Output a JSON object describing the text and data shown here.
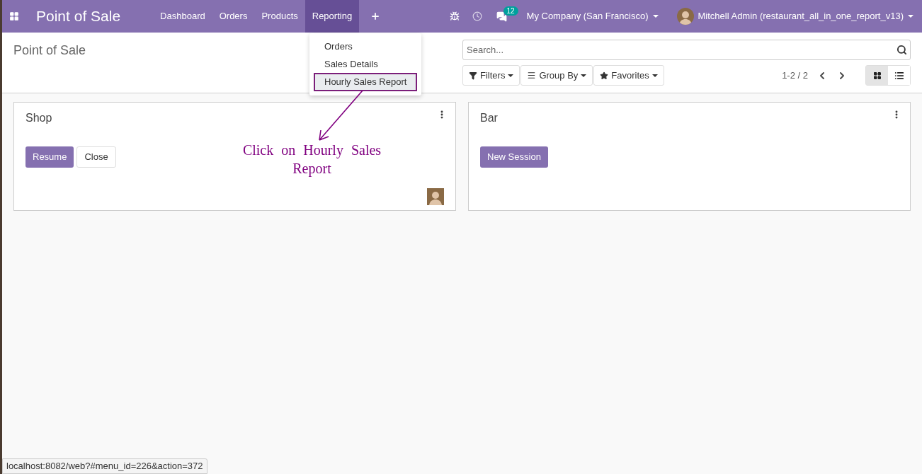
{
  "navbar": {
    "app_name": "Point of Sale",
    "menu": [
      {
        "label": "Dashboard",
        "selected": false
      },
      {
        "label": "Orders",
        "selected": false
      },
      {
        "label": "Products",
        "selected": false
      },
      {
        "label": "Reporting",
        "selected": true
      }
    ],
    "messages_badge": "12",
    "company": "My Company (San Francisco)",
    "user": "Mitchell Admin (restaurant_all_in_one_report_v13)"
  },
  "dropdown": {
    "items": [
      {
        "label": "Orders",
        "selected": false
      },
      {
        "label": "Sales Details",
        "selected": false
      },
      {
        "label": "Hourly Sales Report",
        "selected": true
      }
    ]
  },
  "control_panel": {
    "breadcrumb": "Point of Sale",
    "search": {
      "placeholder": "Search..."
    },
    "filters": [
      {
        "kind": "filter",
        "label": "Filters"
      },
      {
        "kind": "group",
        "label": "Group By"
      },
      {
        "kind": "star",
        "label": "Favorites"
      }
    ],
    "pager": "1-2 / 2",
    "views": [
      {
        "kind": "kanban",
        "selected": true
      },
      {
        "kind": "list",
        "selected": false
      }
    ]
  },
  "cards": [
    {
      "title": "Shop",
      "buttons": [
        {
          "kind": "primary",
          "label": "Resume"
        },
        {
          "kind": "secondary",
          "label": "Close"
        }
      ],
      "avatar": true
    },
    {
      "title": "Bar",
      "buttons": [
        {
          "kind": "primary",
          "label": "New Session"
        }
      ],
      "avatar": false
    }
  ],
  "annotation": "Click on Hourly Sales Report",
  "status_url": "localhost:8082/web?#menu_id=226&action=372"
}
